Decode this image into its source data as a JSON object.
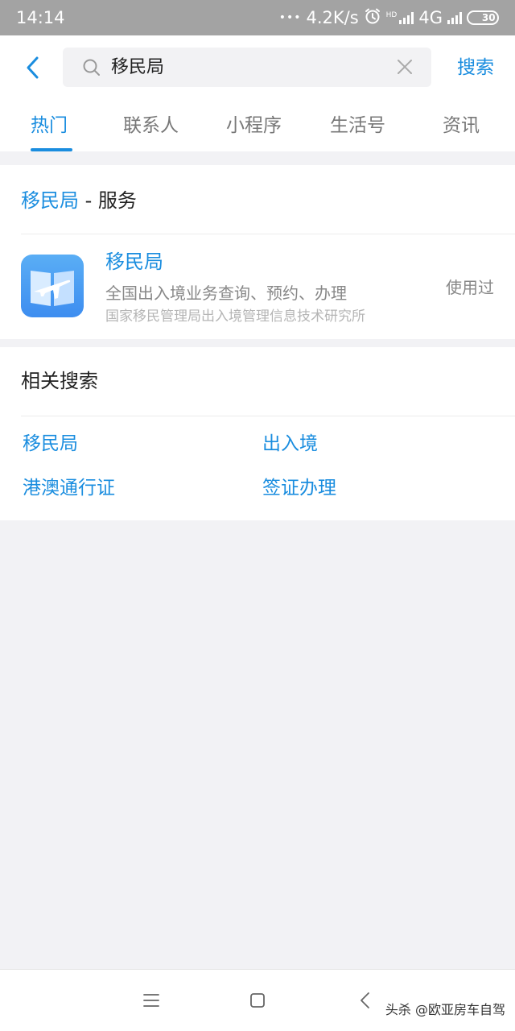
{
  "status_bar": {
    "time": "14:14",
    "dots": "•••",
    "network_speed": "4.2K/s",
    "hd_label": "HD",
    "network_type": "4G",
    "battery": "30"
  },
  "header": {
    "search_query": "移民局",
    "search_button": "搜索"
  },
  "tabs": [
    {
      "label": "热门",
      "active": true
    },
    {
      "label": "联系人",
      "active": false
    },
    {
      "label": "小程序",
      "active": false
    },
    {
      "label": "生活号",
      "active": false
    },
    {
      "label": "资讯",
      "active": false
    }
  ],
  "service_card": {
    "title_keyword": "移民局",
    "title_rest": " - 服务",
    "app": {
      "name": "移民局",
      "description": "全国出入境业务查询、预约、办理",
      "organization": "国家移民管理局出入境管理信息技术研究所",
      "status": "使用过"
    }
  },
  "related": {
    "title": "相关搜索",
    "items": [
      "移民局",
      "出入境",
      "港澳通行证",
      "签证办理"
    ]
  },
  "watermark": "头杀 @欧亚房车自驾",
  "colors": {
    "accent": "#1a8ddf",
    "status_bar": "#a3a3a3",
    "battery": "#6ec33a"
  },
  "icons": {
    "back": "chevron-left-icon",
    "search": "search-icon",
    "clear": "close-icon",
    "app": "plane-book-icon",
    "nav_menu": "menu-icon",
    "nav_home": "square-icon",
    "nav_back": "chevron-left-icon"
  }
}
